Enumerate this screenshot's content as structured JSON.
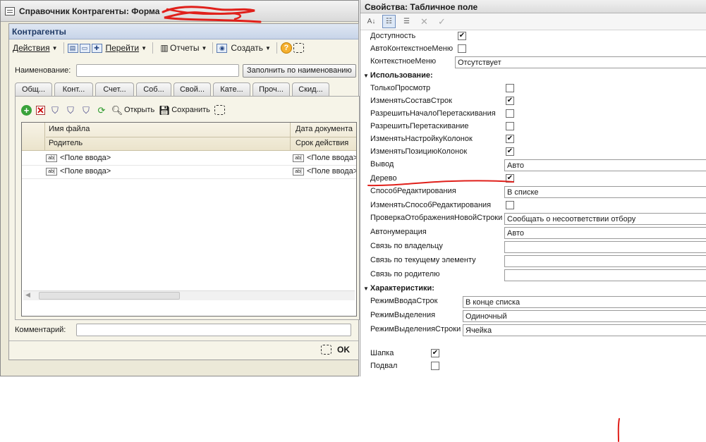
{
  "left_window": {
    "title": "Справочник Контрагенты: Форма",
    "form_header": "Контрагенты",
    "toolbar": {
      "actions": "Действия",
      "goto": "Перейти",
      "reports": "Отчеты",
      "create": "Создать"
    },
    "name_label": "Наименование:",
    "fill_button": "Заполнить по наименованию",
    "tabs": [
      "Общ...",
      "Конт...",
      "Счет...",
      "Соб...",
      "Свой...",
      "Кате...",
      "Проч...",
      "Скид..."
    ],
    "grid_toolbar": {
      "open": "Открыть",
      "save": "Сохранить"
    },
    "grid": {
      "columns_top": [
        "Имя файла",
        "Дата документа"
      ],
      "columns_bottom": [
        "Родитель",
        "Срок действия"
      ],
      "rows": [
        [
          "<Поле ввода>",
          "<Поле ввода>"
        ],
        [
          "<Поле ввода>",
          "<Поле ввода>"
        ]
      ]
    },
    "comment_label": "Комментарий:",
    "ok_button": "OK"
  },
  "properties": {
    "title": "Свойства: Табличное поле",
    "rows": [
      {
        "kind": "check",
        "name": "Доступность",
        "checked": true,
        "col": "A"
      },
      {
        "kind": "check",
        "name": "АвтоКонтекстноеМеню",
        "checked": false,
        "col": "A"
      },
      {
        "kind": "value",
        "name": "КонтекстноеМеню",
        "value": "Отсутствует",
        "col": "A"
      },
      {
        "kind": "group",
        "name": "Использование:"
      },
      {
        "kind": "check",
        "name": "ТолькоПросмотр",
        "checked": false,
        "col": "B"
      },
      {
        "kind": "check",
        "name": "ИзменятьСоставСтрок",
        "checked": true,
        "col": "B"
      },
      {
        "kind": "check",
        "name": "РазрешитьНачалоПеретаскивания",
        "checked": false,
        "col": "B"
      },
      {
        "kind": "check",
        "name": "РазрешитьПеретаскивание",
        "checked": false,
        "col": "B"
      },
      {
        "kind": "check",
        "name": "ИзменятьНастройкуКолонок",
        "checked": true,
        "col": "B"
      },
      {
        "kind": "check",
        "name": "ИзменятьПозициюКолонок",
        "checked": true,
        "col": "B"
      },
      {
        "kind": "value",
        "name": "Вывод",
        "value": "Авто",
        "col": "B"
      },
      {
        "kind": "check",
        "name": "Дерево",
        "checked": true,
        "col": "B"
      },
      {
        "kind": "value",
        "name": "СпособРедактирования",
        "value": "В списке",
        "col": "B"
      },
      {
        "kind": "check",
        "name": "ИзменятьСпособРедактирования",
        "checked": false,
        "col": "B"
      },
      {
        "kind": "value",
        "name": "ПроверкаОтображенияНовойСтроки",
        "value": "Сообщать о несоответствии отбору",
        "col": "B"
      },
      {
        "kind": "value",
        "name": "Автонумерация",
        "value": "Авто",
        "col": "B"
      },
      {
        "kind": "value",
        "name": "Связь по владельцу",
        "value": "",
        "col": "B"
      },
      {
        "kind": "value",
        "name": "Связь по текущему элементу",
        "value": "",
        "col": "B"
      },
      {
        "kind": "value",
        "name": "Связь по родителю",
        "value": "",
        "col": "B"
      },
      {
        "kind": "group",
        "name": "Характеристики:"
      },
      {
        "kind": "value",
        "name": "РежимВводаСтрок",
        "value": "В конце списка",
        "col": "C"
      },
      {
        "kind": "value",
        "name": "РежимВыделения",
        "value": "Одиночный",
        "col": "C"
      },
      {
        "kind": "value",
        "name": "РежимВыделенияСтроки",
        "value": "Ячейка",
        "col": "C"
      },
      {
        "kind": "spacer"
      },
      {
        "kind": "check",
        "name": "Шапка",
        "checked": true,
        "col": "D"
      },
      {
        "kind": "check",
        "name": "Подвал",
        "checked": false,
        "col": "D"
      }
    ]
  },
  "annotation_color": "#e0201b"
}
